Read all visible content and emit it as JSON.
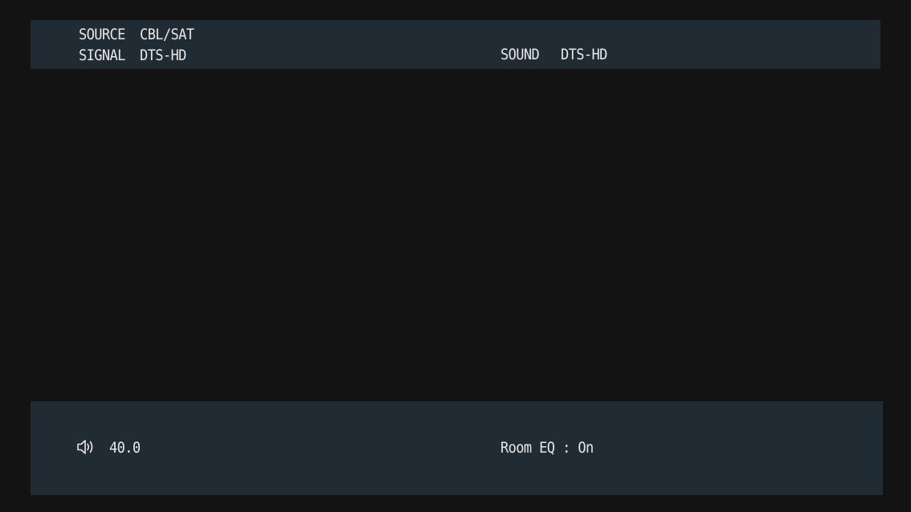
{
  "status_bar": {
    "source_label": "SOURCE",
    "source_value": "CBL/SAT",
    "signal_label": "SIGNAL",
    "signal_value": "DTS-HD",
    "sound_label": "SOUND",
    "sound_value": "DTS-HD"
  },
  "bottom_bar": {
    "volume_icon": "speaker-volume-icon",
    "volume_value": "40.0",
    "room_eq": "Room EQ : On"
  },
  "colors": {
    "background": "#131313",
    "panel": "#212b34",
    "text": "#e8e8e8"
  }
}
